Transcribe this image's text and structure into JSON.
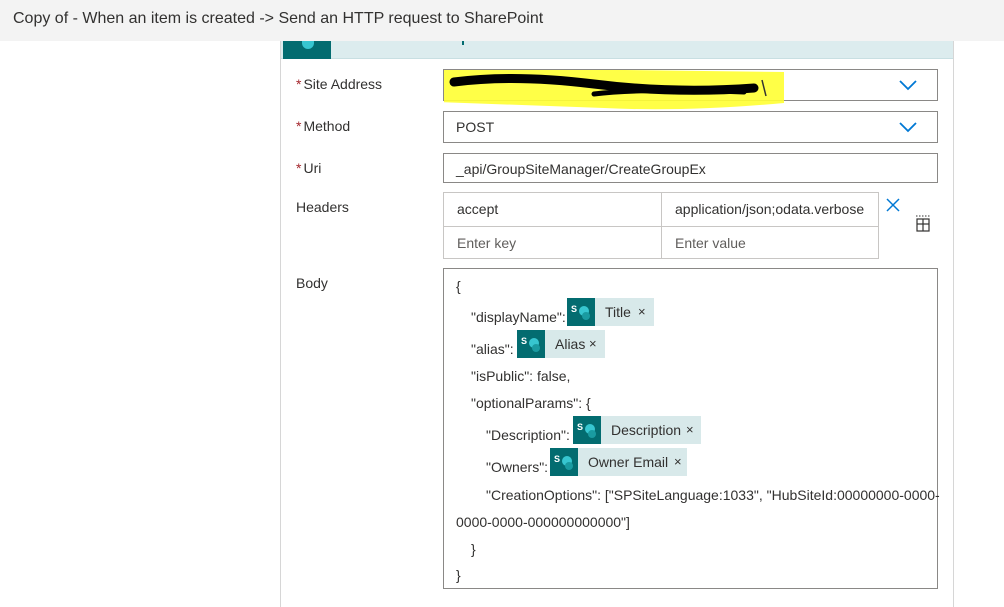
{
  "window": {
    "title": "Copy of - When an item is created -> Send an HTTP request to SharePoint"
  },
  "form": {
    "site_address": {
      "label": "Site Address",
      "required": "*",
      "value": ""
    },
    "method": {
      "label": "Method",
      "required": "*",
      "value": "POST"
    },
    "uri": {
      "label": "Uri",
      "required": "*",
      "value": "_api/GroupSiteManager/CreateGroupEx"
    },
    "headers": {
      "label": "Headers",
      "rows": [
        {
          "key": "accept",
          "value": "application/json;odata.verbose"
        }
      ],
      "key_placeholder": "Enter key",
      "value_placeholder": "Enter value"
    },
    "body": {
      "label": "Body",
      "lines": {
        "open": "{",
        "display_name": "\"displayName\":",
        "alias": "\"alias\":",
        "is_public": "\"isPublic\": false,",
        "optional_params": "\"optionalParams\": {",
        "description": "\"Description\":",
        "owners": "\"Owners\":",
        "creation_options_1": "\"CreationOptions\": [\"SPSiteLanguage:1033\", \"HubSiteId:00000000-0000-",
        "creation_options_2": "0000-0000-000000000000\"]",
        "close_inner": "}",
        "close_outer": "}"
      },
      "tokens": {
        "title": "Title",
        "alias": "Alias",
        "description": "Description",
        "owner_email": "Owner Email"
      }
    }
  },
  "icons": {
    "dropdown": "chevron-down-icon",
    "remove_header": "close-icon",
    "switch_mode": "switch-to-text-mode-icon",
    "sharepoint": "sharepoint-icon",
    "token_remove": "close-icon"
  },
  "glyphs": {
    "close": "×",
    "sharepoint_letter": "S"
  },
  "colors": {
    "accent": "#0078d4",
    "required": "#a4262c",
    "sharepoint": "#036c70",
    "token_bg": "#d8e9ea",
    "highlight": "#ffff33"
  }
}
